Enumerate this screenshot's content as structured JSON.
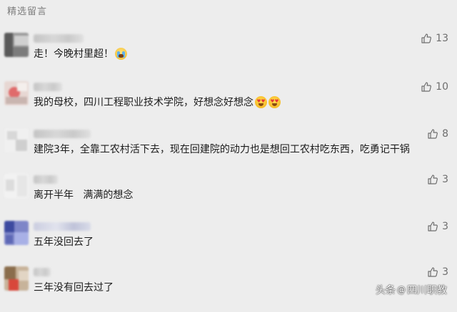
{
  "section_title": "精选留言",
  "comments": [
    {
      "text": "走！今晚村里超！",
      "likes": "13",
      "emojis": [
        "crying-face"
      ]
    },
    {
      "text": "我的母校，四川工程职业技术学院，好想念好想念",
      "likes": "10",
      "emojis": [
        "heart-eyes-face",
        "heart-eyes-face"
      ]
    },
    {
      "text": "建院3年，全靠工农村活下去，现在回建院的动力也是想回工农村吃东西，吃勇记干锅",
      "likes": "8",
      "emojis": []
    },
    {
      "text": "离开半年   满满的想念",
      "likes": "3",
      "emojis": []
    },
    {
      "text": "五年没回去了",
      "likes": "3",
      "emojis": []
    },
    {
      "text": "三年没有回去过了",
      "likes": "3",
      "emojis": []
    }
  ],
  "watermark": {
    "left": "头条",
    "right": "四川职教"
  },
  "colors": {
    "background": "#ededed",
    "text": "#1c1c1c",
    "muted": "#7d7d7d"
  }
}
